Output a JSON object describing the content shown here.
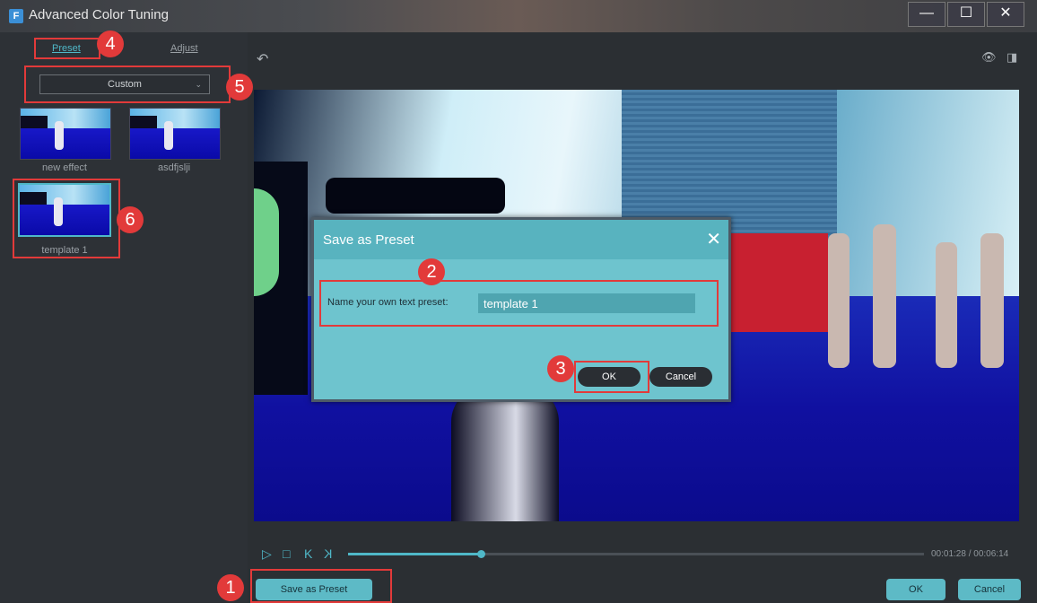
{
  "window": {
    "title": "Advanced Color Tuning",
    "icon_letter": "F",
    "controls": {
      "minimize": "—",
      "maximize": "☐",
      "close": "✕"
    }
  },
  "left_panel": {
    "tabs": {
      "preset": "Preset",
      "adjust": "Adjust"
    },
    "dropdown": {
      "selected": "Custom",
      "chevron": "⌄"
    },
    "presets": [
      {
        "label": "new effect"
      },
      {
        "label": "asdfjslji"
      },
      {
        "label": "template 1"
      }
    ]
  },
  "toolbar": {
    "undo_icon": "undo-icon",
    "undo_glyph": "↶",
    "eye_glyph": "👁",
    "compare_glyph": "◨"
  },
  "dialog": {
    "title": "Save as Preset",
    "close_glyph": "✕",
    "field_label": "Name your own text preset:",
    "field_value": "template 1",
    "ok_label": "OK",
    "cancel_label": "Cancel"
  },
  "playback": {
    "play_glyph": "▷",
    "stop_glyph": "□",
    "prev_glyph": "K",
    "next_glyph": "K",
    "progress": 0.23,
    "timecode": "00:01:28 / 00:06:14"
  },
  "buttons": {
    "save_preset": "Save as Preset",
    "ok": "OK",
    "cancel": "Cancel"
  },
  "annotations": [
    "1",
    "2",
    "3",
    "4",
    "5",
    "6"
  ],
  "colors": {
    "accent": "#4fb8c8",
    "annotation": "#e23a3a",
    "dialog_bg": "#6ec4ce"
  }
}
